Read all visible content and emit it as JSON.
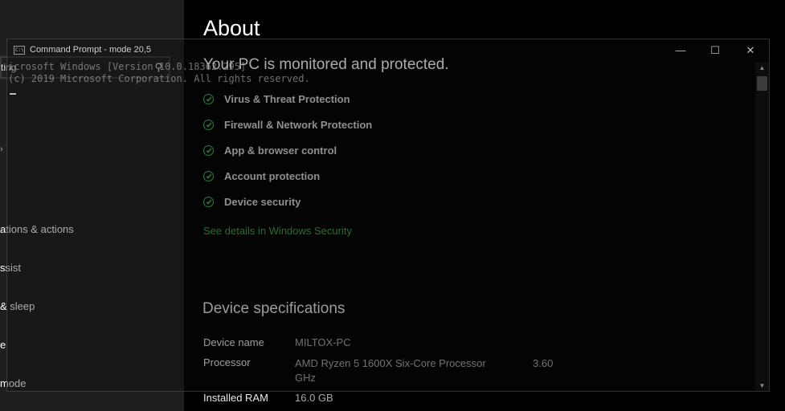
{
  "sidebar": {
    "search_stub_text": "ting",
    "items": [
      {
        "label": "ations & actions"
      },
      {
        "label": "ssist"
      },
      {
        "label": "& sleep"
      },
      {
        "label": "e"
      },
      {
        "label": "mode"
      }
    ]
  },
  "about": {
    "title": "About",
    "protection_heading": "Your PC is monitored and protected.",
    "statuses": [
      {
        "label": "Virus & Threat Protection"
      },
      {
        "label": "Firewall & Network Protection"
      },
      {
        "label": "App & browser control"
      },
      {
        "label": "Account protection"
      },
      {
        "label": "Device security"
      }
    ],
    "security_link": "See details in Windows Security",
    "status_color": "#3dbb55"
  },
  "specs": {
    "heading": "Device specifications",
    "rows": [
      {
        "label": "Device name",
        "value": "MILTOX-PC"
      },
      {
        "label": "Processor",
        "value": "AMD Ryzen 5 1600X Six-Core Processor GHz",
        "extra": "3.60"
      },
      {
        "label": "Installed RAM",
        "value": "16.0 GB"
      }
    ]
  },
  "cmd": {
    "title": "Command Prompt - mode  20,5",
    "lines": [
      "icrosoft Windows [Version 10.0.18362.295]",
      "(c) 2019 Microsoft Corporation. All rights reserved."
    ],
    "icon": "cmd-icon",
    "minimize_glyph": "—",
    "maximize_glyph": "☐",
    "close_glyph": "✕"
  }
}
